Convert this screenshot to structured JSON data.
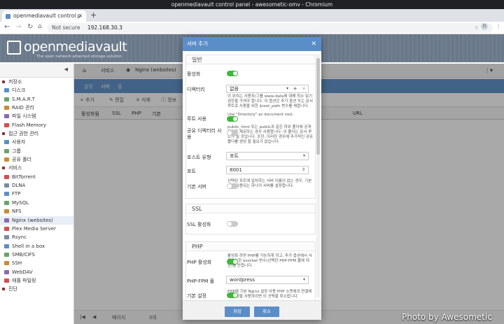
{
  "browser": {
    "window_title": "openmediavault control panel - awesometic-omv - Chromium",
    "tab_title": "openmediavault control p",
    "new_tab": "+",
    "not_secure": "Not secure",
    "url": "192.168.30.3",
    "profile_initial": "D"
  },
  "header": {
    "logo": "openmediavault",
    "tagline": "The open network attached storage solution"
  },
  "sidebar": {
    "items": [
      {
        "label": "저장소",
        "header": true,
        "icon": "storage-icon"
      },
      {
        "label": "디스크",
        "icon": "disk-icon"
      },
      {
        "label": "S.M.A.R.T",
        "icon": "smart-icon"
      },
      {
        "label": "RAID 관리",
        "icon": "raid-icon"
      },
      {
        "label": "파일 시스템",
        "icon": "filesystem-icon"
      },
      {
        "label": "Flash Memory",
        "icon": "flash-icon"
      },
      {
        "label": "접근 권한 관리",
        "header": true,
        "icon": "access-icon"
      },
      {
        "label": "사용자",
        "icon": "user-icon"
      },
      {
        "label": "그룹",
        "icon": "group-icon"
      },
      {
        "label": "공유 폴더",
        "icon": "share-icon"
      },
      {
        "label": "서비스",
        "header": true,
        "icon": "services-icon"
      },
      {
        "label": "BitTorrent",
        "icon": "bittorrent-icon"
      },
      {
        "label": "DLNA",
        "icon": "dlna-icon"
      },
      {
        "label": "FTP",
        "icon": "ftp-icon"
      },
      {
        "label": "MySQL",
        "icon": "mysql-icon"
      },
      {
        "label": "NFS",
        "icon": "nfs-icon"
      },
      {
        "label": "Nginx (websites)",
        "icon": "nginx-icon",
        "selected": true
      },
      {
        "label": "Plex Media Server",
        "icon": "plex-icon"
      },
      {
        "label": "Rsync",
        "icon": "rsync-icon"
      },
      {
        "label": "Shell in a box",
        "icon": "shell-icon"
      },
      {
        "label": "SMB/CIFS",
        "icon": "smb-icon"
      },
      {
        "label": "SSH",
        "icon": "ssh-icon"
      },
      {
        "label": "WebDAV",
        "icon": "webdav-icon"
      },
      {
        "label": "애플 파일링",
        "icon": "afp-icon"
      },
      {
        "label": "진단",
        "header": true,
        "icon": "diagnostics-icon"
      }
    ]
  },
  "main": {
    "breadcrumb": [
      "서비스",
      "Nginx (websites)"
    ],
    "tabs": [
      "설정",
      "서버",
      "풀"
    ],
    "actions": [
      "추가",
      "편집",
      "삭제",
      "정보"
    ],
    "columns": [
      "활성화됨",
      "SSL",
      "PHP",
      "기본",
      "URL"
    ],
    "pager": {
      "page_label": "페이지",
      "of": "0의"
    }
  },
  "dialog": {
    "title": "서버 추가",
    "sections": {
      "general": "일반",
      "ssl": "SSL",
      "php": "PHP"
    },
    "fields": {
      "enable": {
        "label": "활성화",
        "value": true
      },
      "directory": {
        "label": "디렉터리",
        "value": "없음",
        "hint": "이 위치는 사용자/그룹 www-data에 대해 최소 읽기\n권한을 가져야 합니다. 이 옵션은 추가 옵션 또는 문서\n루트로 사용을 위한 $root_path 변수를 채웁니다."
      },
      "root": {
        "label": "루트 사용",
        "value": true,
        "hint": "Use \"Directory\" as document root."
      },
      "public": {
        "label": "공유 디렉터리 사용",
        "value": false,
        "hint": "public_html 또는 public과 같은 하위 폴더에 공개\n파일을 제공하는 경우 사용합니다. 이 폴더는 문서 루\n트가 될 것입니다. 또한, 이러한 경우에 추가적인 공유\n폴더를 생성 할 필요가 없습니다."
      },
      "host_type": {
        "label": "호스트 유형",
        "value": "포트"
      },
      "port": {
        "label": "포트",
        "value": "8001"
      },
      "default_server": {
        "label": "기본 서버",
        "value": false,
        "hint": "선택된 포트에 일치하는 서버 이름이 없는 경우, 기본\n으로 사용되는 하나의 서버를 설정합니다."
      },
      "ssl_enable": {
        "label": "SSL 활성화",
        "value": false
      },
      "php_enable": {
        "label": "PHP 활성화",
        "value": true,
        "hint": "활성화 하면 PHP를 가능하게 하고, 추가 옵션에서 사\n용가능한 $socket 변수(선택한 PHP-FPM 풀에 대\n한)를 만듭니다."
      },
      "php_pool": {
        "label": "PHP-FPM 풀",
        "value": "wordpress"
      },
      "default_settings": {
        "label": "기본 설정",
        "value": true,
        "hint": "PHP에 기본 Nginx 설정 사용 PHP 소켓에의 연결에\n서 구성을 사용하려면 이 선택을 취소합니다."
      }
    },
    "buttons": {
      "save": "저장",
      "cancel": "취소"
    }
  },
  "watermark": "Photo by Awesometic",
  "colors": {
    "accent": "#5a8ec9",
    "toggle_on": "#3db83d",
    "toggle_off": "#c9c9c9"
  }
}
